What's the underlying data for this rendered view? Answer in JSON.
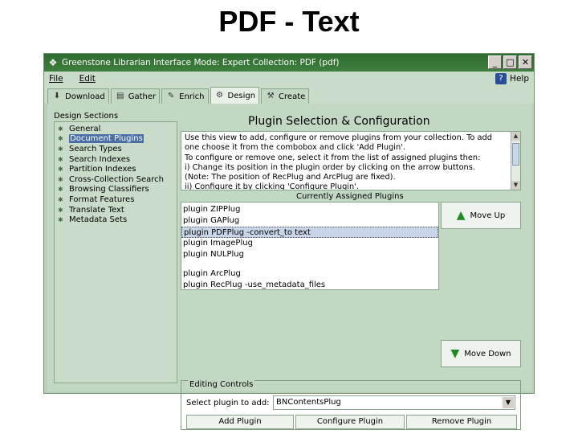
{
  "slide": {
    "title": "PDF - Text"
  },
  "window": {
    "title": "Greenstone Librarian Interface  Mode: Expert  Collection: PDF (pdf)",
    "controls": {
      "minimize": "_",
      "maximize": "□",
      "close": "✕"
    }
  },
  "menu": {
    "file": "File",
    "edit": "Edit",
    "help": "Help"
  },
  "tabs": [
    {
      "label": "Download"
    },
    {
      "label": "Gather"
    },
    {
      "label": "Enrich"
    },
    {
      "label": "Design"
    },
    {
      "label": "Create"
    }
  ],
  "design_sections": {
    "label": "Design Sections",
    "items": [
      "General",
      "Document Plugins",
      "Search Types",
      "Search Indexes",
      "Partition Indexes",
      "Cross-Collection Search",
      "Browsing Classifiers",
      "Format Features",
      "Translate Text",
      "Metadata Sets"
    ]
  },
  "panel": {
    "title": "Plugin Selection & Configuration",
    "instructions": [
      "Use this view to add, configure or remove plugins from your collection. To add",
      "one choose it from the combobox and click 'Add Plugin'.",
      "To configure or remove one, select it from the list of assigned plugins then:",
      "i)   Change its position in the plugin order by clicking on the arrow buttons.",
      "(Note: The position of RecPlug and ArcPlug are fixed).",
      "ii)  Configure it by clicking 'Configure Plugin'."
    ],
    "assigned_label": "Currently Assigned Plugins",
    "plugins_top": [
      "plugin ZIPPlug",
      "plugin GAPlug",
      "plugin PDFPlug -convert_to text",
      "plugin ImagePlug",
      "plugin NULPlug"
    ],
    "plugins_fixed": [
      "plugin ArcPlug",
      "plugin RecPlug -use_metadata_files"
    ],
    "move_up": "Move Up",
    "move_down": "Move Down"
  },
  "editing": {
    "label": "Editing Controls",
    "select_label": "Select plugin to add:",
    "selected_plugin": "BNContentsPlug",
    "add": "Add Plugin",
    "configure": "Configure Plugin",
    "remove": "Remove Plugin"
  }
}
